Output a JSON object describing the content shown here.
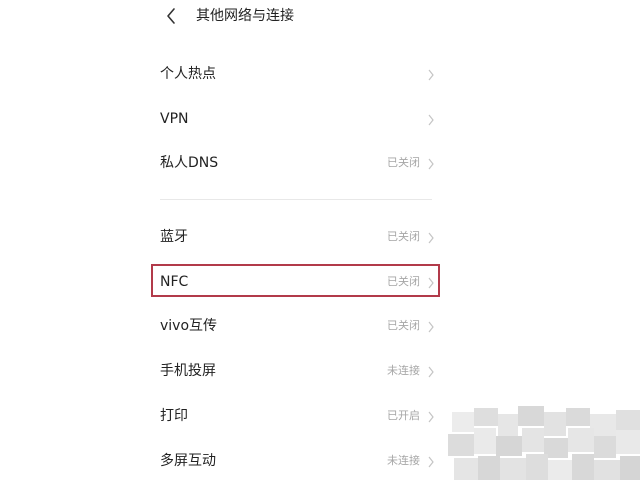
{
  "header": {
    "title": "其他网络与连接",
    "back_icon": "back-chevron-icon"
  },
  "list": {
    "group_1": [
      {
        "label": "个人热点",
        "status": ""
      },
      {
        "label": "VPN",
        "status": ""
      },
      {
        "label": "私人DNS",
        "status": "已关闭"
      }
    ],
    "group_2": [
      {
        "label": "蓝牙",
        "status": "已关闭"
      },
      {
        "label": "NFC",
        "status": "已关闭"
      },
      {
        "label": "vivo互传",
        "status": "已关闭"
      },
      {
        "label": "手机投屏",
        "status": "未连接"
      },
      {
        "label": "打印",
        "status": "已开启"
      },
      {
        "label": "多屏互动",
        "status": "未连接"
      }
    ]
  },
  "highlight": {
    "target": "NFC",
    "color": "#b23a4a"
  },
  "colors": {
    "text": "#222222",
    "status": "#a6a6a6",
    "chevron": "#c4c4c4",
    "divider": "#e8e8e8"
  },
  "watermark": "pixelated-logo"
}
